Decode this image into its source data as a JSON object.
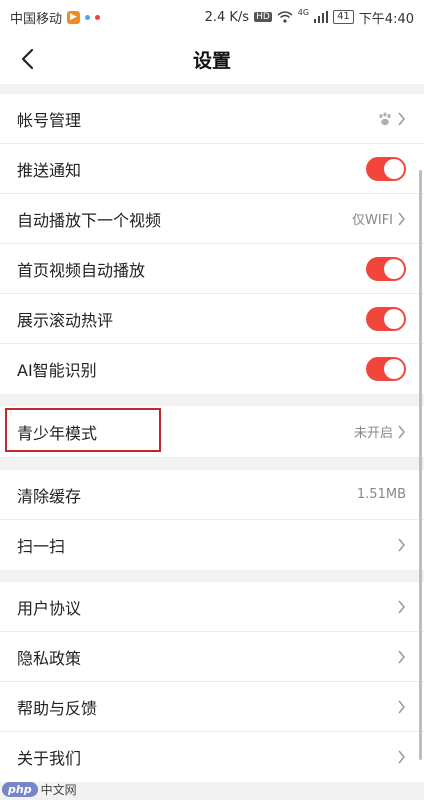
{
  "status_bar": {
    "carrier": "中国移动",
    "speed": "2.4 K/s",
    "hd": "HD",
    "network": "4G",
    "battery": "41",
    "time": "下午4:40"
  },
  "header": {
    "title": "设置"
  },
  "groups": [
    {
      "rows": [
        {
          "label": "帐号管理",
          "icon": "paw-icon"
        },
        {
          "label": "推送通知",
          "toggle": true
        },
        {
          "label": "自动播放下一个视频",
          "value": "仅WIFI"
        },
        {
          "label": "首页视频自动播放",
          "toggle": true
        },
        {
          "label": "展示滚动热评",
          "toggle": true
        },
        {
          "label": "AI智能识别",
          "toggle": true
        }
      ]
    },
    {
      "rows": [
        {
          "label": "青少年模式",
          "value": "未开启"
        }
      ]
    },
    {
      "rows": [
        {
          "label": "清除缓存",
          "value": "1.51MB"
        },
        {
          "label": "扫一扫"
        }
      ]
    },
    {
      "rows": [
        {
          "label": "用户协议"
        },
        {
          "label": "隐私政策"
        },
        {
          "label": "帮助与反馈"
        },
        {
          "label": "关于我们"
        }
      ]
    }
  ],
  "watermark": {
    "logo": "php",
    "text": "中文网"
  },
  "colors": {
    "toggle_on": "#f2463c",
    "highlight_box": "#c4262e"
  }
}
